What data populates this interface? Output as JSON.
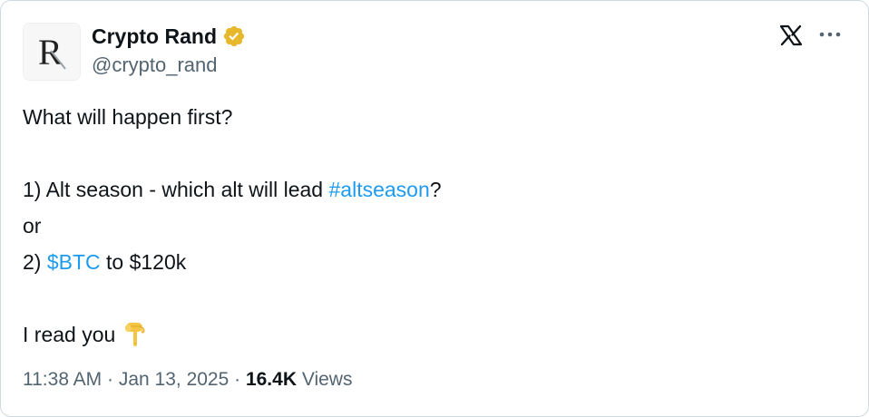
{
  "author": {
    "display_name": "Crypto Rand",
    "handle": "@crypto_rand",
    "avatar_letter": "R",
    "verified_badge": "verified-badge-gold"
  },
  "header_actions": {
    "platform_logo": "x-logo-icon",
    "more": "more-options-icon"
  },
  "tweet": {
    "line1": "What will happen first?",
    "line3_prefix": "1) Alt season - which alt will lead ",
    "hashtag": "#altseason",
    "line3_suffix": "?",
    "line4": "or",
    "line5_prefix": "2) ",
    "cashtag": "$BTC",
    "line5_suffix": " to $120k",
    "line7": "I read you",
    "emoji": "backhand-index-pointing-down"
  },
  "meta": {
    "time": "11:38 AM",
    "sep1": " · ",
    "date": "Jan 13, 2025",
    "sep2": " · ",
    "views_count": "16.4K",
    "views_label": " Views"
  },
  "colors": {
    "link": "#1d9bf0",
    "text": "#0f1419",
    "secondary": "#536471",
    "border": "#cfd9de",
    "badge": "#e8b82c"
  }
}
